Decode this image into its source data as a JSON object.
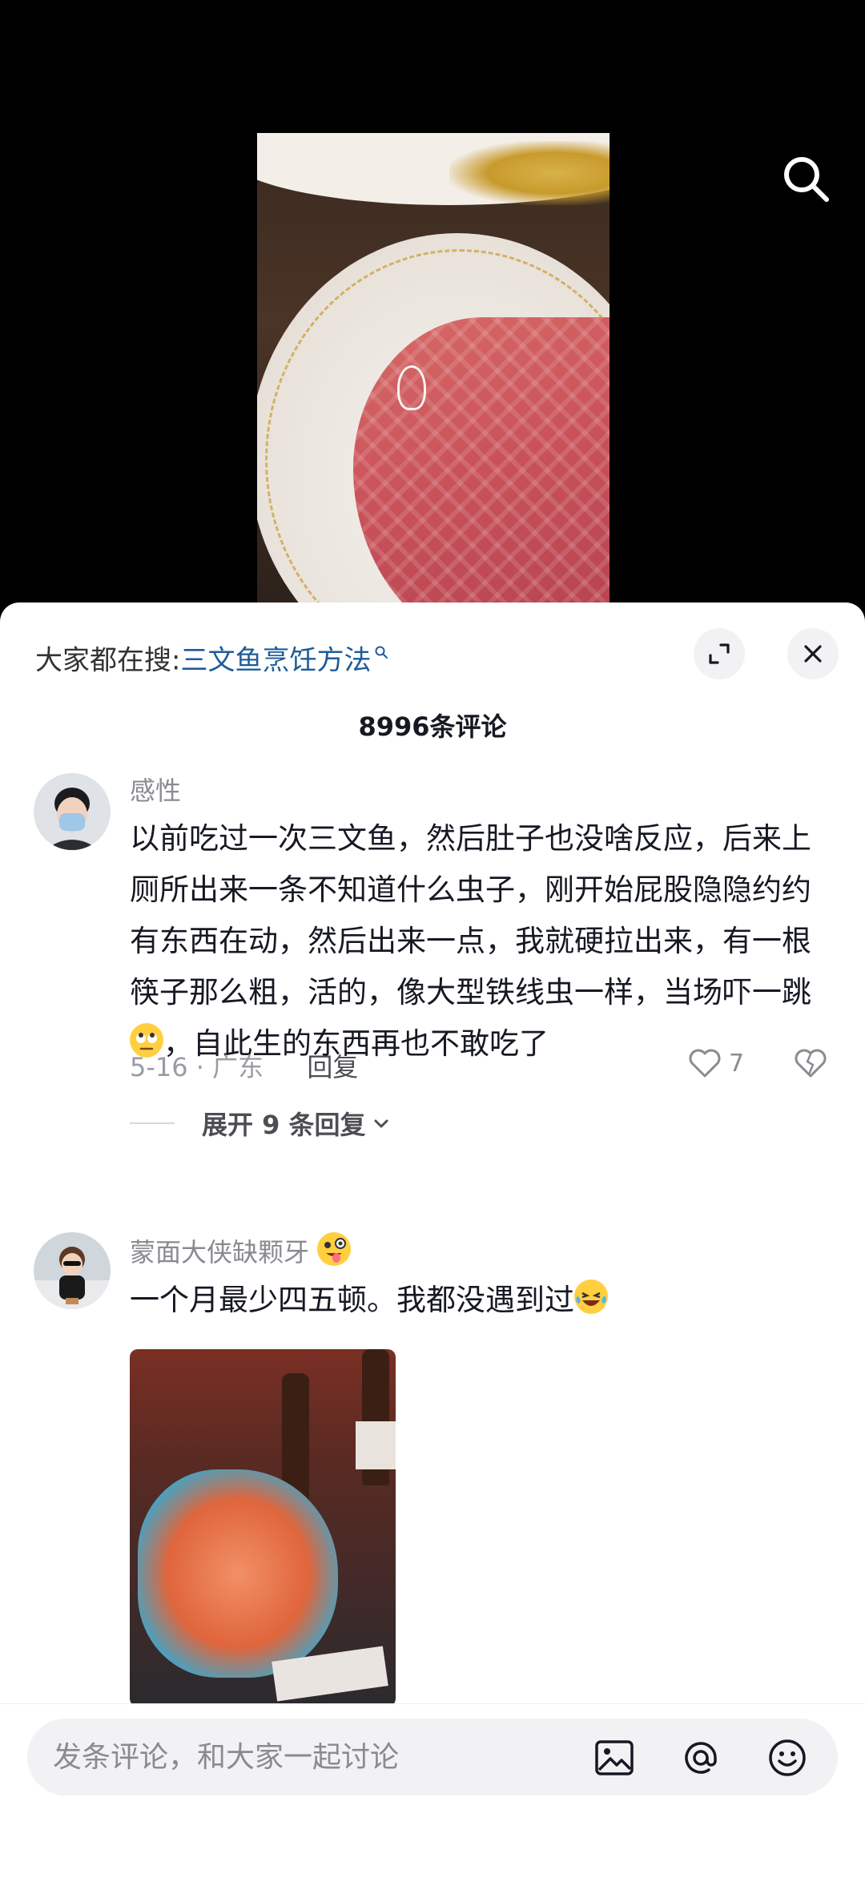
{
  "video": {
    "search_icon": "search-icon"
  },
  "sheet": {
    "hot_search_prefix": "大家都在搜:",
    "hot_search_keyword": "三文鱼烹饪方法",
    "comment_count": "8996条评论",
    "expand_icon": "expand-icon",
    "close_icon": "close-icon"
  },
  "comments": [
    {
      "username": "感性",
      "text": "以前吃过一次三文鱼，然后肚子也没啥反应，后来上厕所出来一条不知道什么虫子，刚开始屁股隐隐约约有东西在动，然后出来一点，我就硬拉出来，有一根筷子那么粗，活的，像大型铁线虫一样，当场吓一跳",
      "text_tail": "，自此生的东西再也不敢吃了",
      "emoji": "rolling-eyes-emoji",
      "date_location": "5-16 · 广东",
      "reply_label": "回复",
      "likes": "7",
      "expand_replies": "展开 9 条回复"
    },
    {
      "username": "蒙面大侠缺颗牙",
      "username_emoji": "zany-face-emoji",
      "text": "一个月最少四五顿。我都没遇到过",
      "emoji": "laughing-crying-emoji"
    }
  ],
  "input_bar": {
    "placeholder": "发条评论，和大家一起讨论",
    "image_icon": "image-icon",
    "at_icon": "at-icon",
    "emoji_icon": "emoji-icon"
  },
  "colors": {
    "keyword_blue": "#1e5c97",
    "text_primary": "#161823",
    "text_secondary": "#8a8b91",
    "sheet_background": "#ffffff",
    "video_background": "#000000"
  }
}
